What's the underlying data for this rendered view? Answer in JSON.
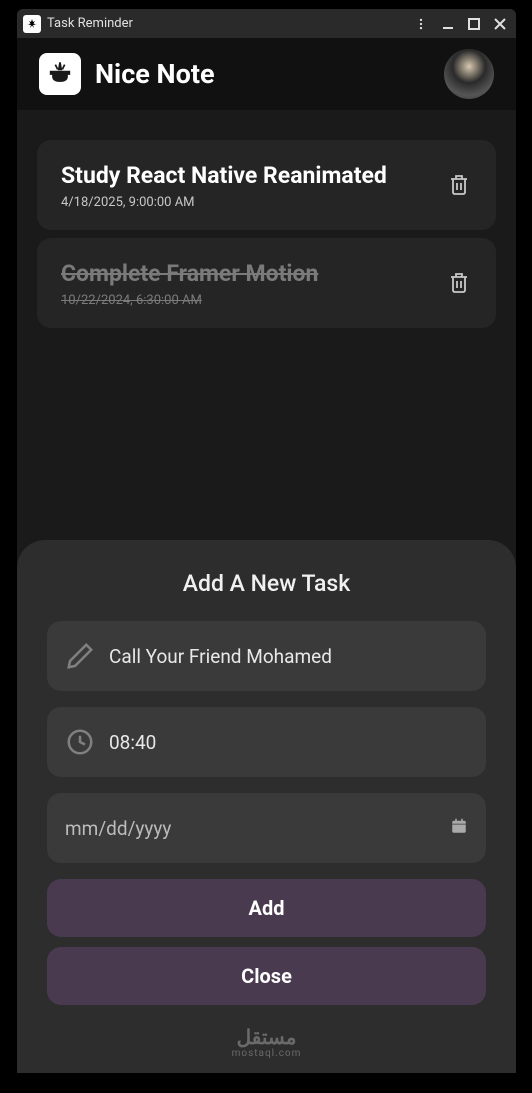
{
  "window": {
    "title": "Task Reminder"
  },
  "header": {
    "app_title": "Nice Note"
  },
  "tasks": [
    {
      "title": "Study React Native Reanimated",
      "date": "4/18/2025, 9:00:00 AM",
      "done": false
    },
    {
      "title": "Complete Framer Motion",
      "date": "10/22/2024, 6:30:00 AM",
      "done": true
    }
  ],
  "modal": {
    "title": "Add A New Task",
    "task_name_value": "Call Your Friend Mohamed",
    "time_value": "08:40",
    "date_placeholder": "mm/dd/yyyy",
    "add_label": "Add",
    "close_label": "Close"
  },
  "footer": {
    "brand_arabic": "مستقل",
    "brand_latin": "mostaql.com"
  }
}
